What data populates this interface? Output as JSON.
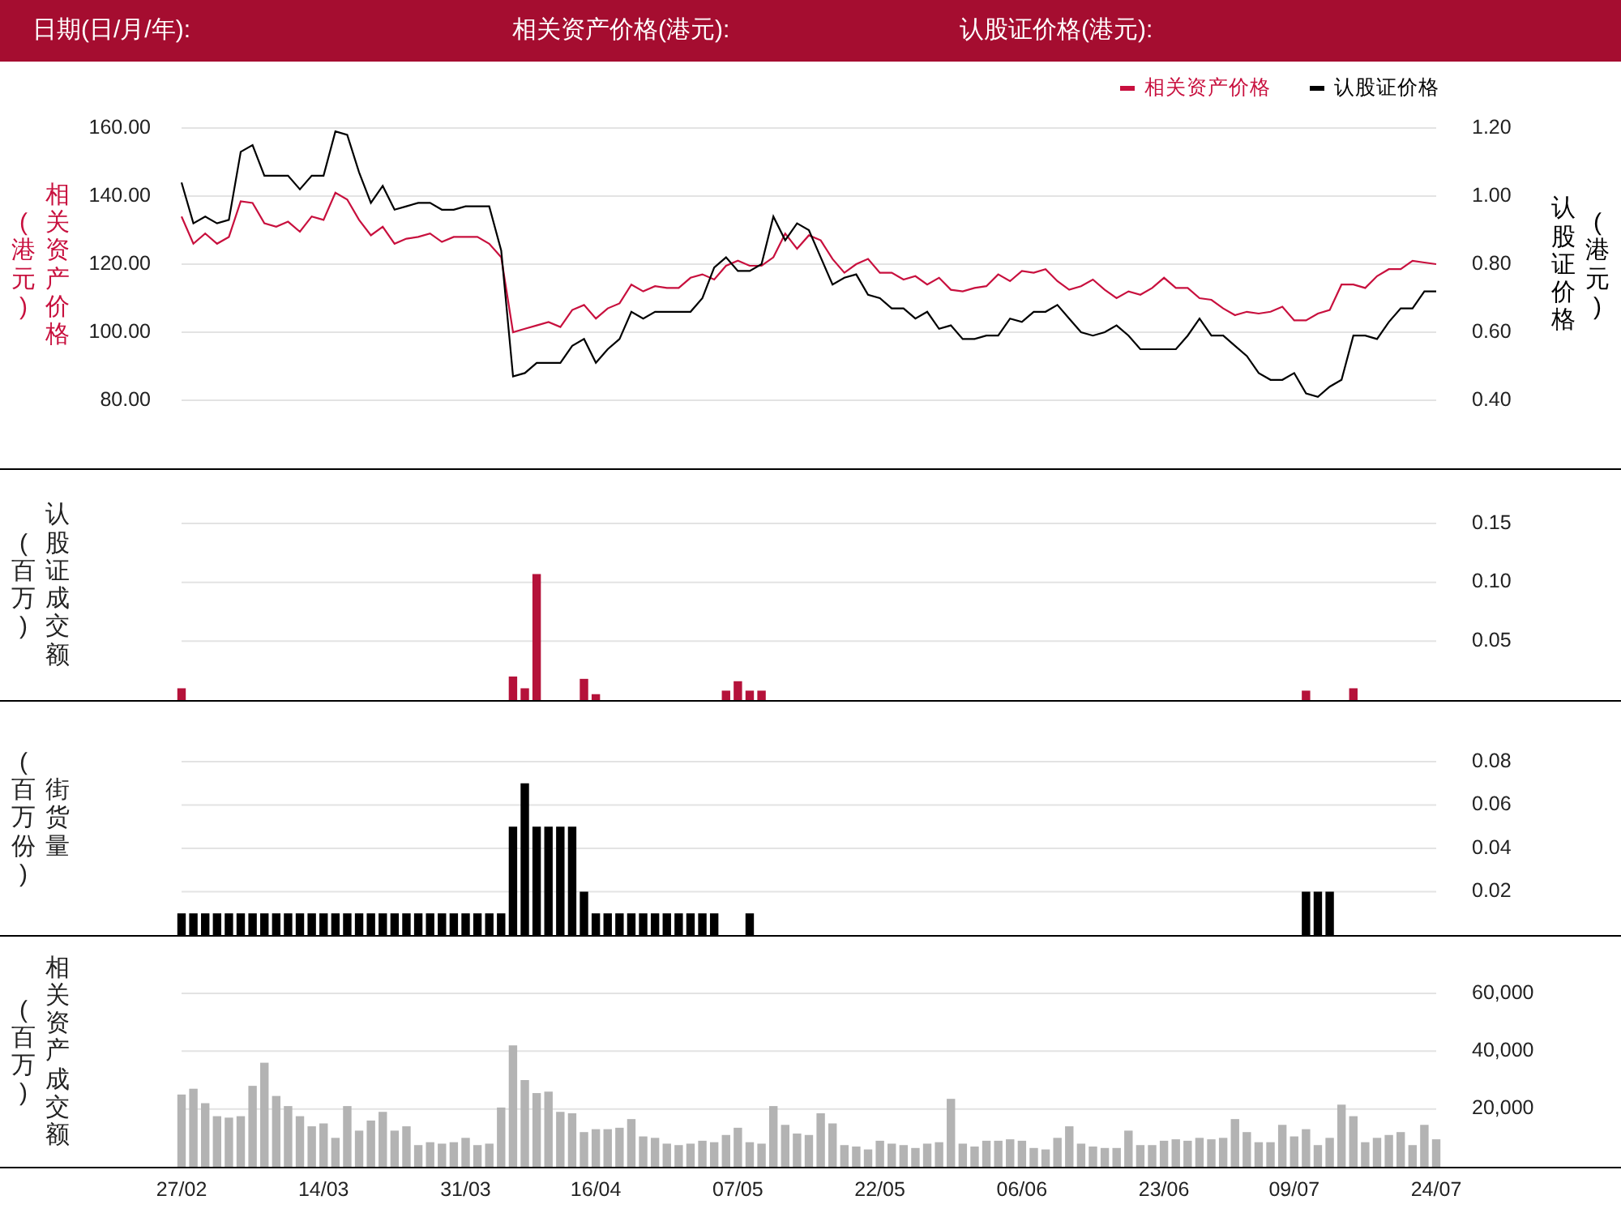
{
  "header": {
    "labels": [
      "日期(日/月/年):",
      "相关资产价格(港元):",
      "认股证价格(港元):"
    ]
  },
  "price_chart": {
    "y_unit": "(港元)",
    "y2_unit": "(港元)",
    "chart_data": {
      "type": "line",
      "ylabel": "相关资产价格",
      "y2label": "认股证价格",
      "legend": "top-right",
      "grid": true,
      "ylim": [
        80,
        160
      ],
      "y2lim": [
        0.4,
        1.2
      ],
      "yticks": [
        {
          "value": 80,
          "label": "80.00"
        },
        {
          "value": 100,
          "label": "100.00"
        },
        {
          "value": 120,
          "label": "120.00"
        },
        {
          "value": 140,
          "label": "140.00"
        },
        {
          "value": 160,
          "label": "160.00"
        }
      ],
      "y2ticks": [
        {
          "value": 0.4,
          "label": "0.40"
        },
        {
          "value": 0.6,
          "label": "0.60"
        },
        {
          "value": 0.8,
          "label": "0.80"
        },
        {
          "value": 1.0,
          "label": "1.00"
        },
        {
          "value": 1.2,
          "label": "1.20"
        }
      ],
      "series": [
        {
          "name": "相关资产价格",
          "color": "#c8103e",
          "values": [
            134,
            126,
            129,
            126,
            128,
            138.5,
            138,
            132,
            131,
            132.5,
            129.5,
            134,
            133,
            141,
            139,
            133,
            128.5,
            131,
            126,
            127.5,
            128,
            129,
            126.5,
            128,
            128,
            128,
            126,
            122,
            100,
            101,
            102,
            103,
            101.5,
            106.5,
            108,
            104,
            107,
            108.5,
            114,
            112,
            113.5,
            113,
            113,
            116,
            117,
            115.5,
            119.5,
            121,
            119.5,
            119.5,
            122,
            129,
            124.5,
            128.5,
            127,
            121.5,
            117.5,
            120,
            121.5,
            117.5,
            117.5,
            115.5,
            116.5,
            114,
            116,
            112.5,
            112,
            113,
            113.5,
            117,
            115,
            118,
            117.5,
            118.5,
            115,
            112.5,
            113.5,
            115.5,
            112.5,
            110,
            112,
            111,
            113,
            116,
            113,
            113,
            110,
            109.5,
            107,
            105,
            106,
            105.5,
            106,
            107.5,
            103.5,
            103.5,
            105.5,
            106.5,
            114,
            114,
            113,
            116.5,
            118.5,
            118.5,
            121,
            120.5,
            120
          ]
        },
        {
          "name": "认股证价格",
          "color": "#000000",
          "axis": "y2",
          "values": [
            1.04,
            0.92,
            0.94,
            0.92,
            0.93,
            1.13,
            1.15,
            1.06,
            1.06,
            1.06,
            1.02,
            1.06,
            1.06,
            1.19,
            1.18,
            1.07,
            0.98,
            1.03,
            0.96,
            0.97,
            0.98,
            0.98,
            0.96,
            0.96,
            0.97,
            0.97,
            0.97,
            0.84,
            0.47,
            0.48,
            0.51,
            0.51,
            0.51,
            0.56,
            0.58,
            0.51,
            0.55,
            0.58,
            0.66,
            0.64,
            0.66,
            0.66,
            0.66,
            0.66,
            0.7,
            0.79,
            0.82,
            0.78,
            0.78,
            0.8,
            0.94,
            0.87,
            0.92,
            0.9,
            0.82,
            0.74,
            0.76,
            0.77,
            0.71,
            0.7,
            0.67,
            0.67,
            0.64,
            0.66,
            0.61,
            0.62,
            0.58,
            0.58,
            0.59,
            0.59,
            0.64,
            0.63,
            0.66,
            0.66,
            0.68,
            0.64,
            0.6,
            0.59,
            0.6,
            0.62,
            0.59,
            0.55,
            0.55,
            0.55,
            0.55,
            0.59,
            0.64,
            0.59,
            0.59,
            0.56,
            0.53,
            0.48,
            0.46,
            0.46,
            0.48,
            0.42,
            0.41,
            0.44,
            0.46,
            0.59,
            0.59,
            0.58,
            0.63,
            0.67,
            0.67,
            0.72,
            0.72
          ]
        }
      ]
    }
  },
  "warrant_turnover_chart": {
    "y_unit": "(百万)",
    "chart_data": {
      "type": "bar",
      "ylabel": "认股证成交额",
      "grid": true,
      "ylim": [
        0,
        0.15
      ],
      "yticks": [
        {
          "value": 0.05,
          "label": "0.05"
        },
        {
          "value": 0.1,
          "label": "0.10"
        },
        {
          "value": 0.15,
          "label": "0.15"
        }
      ],
      "series": [
        {
          "color": "#b5123a",
          "values": [
            0.01,
            null,
            null,
            null,
            null,
            null,
            null,
            null,
            null,
            null,
            null,
            null,
            null,
            null,
            null,
            null,
            null,
            null,
            null,
            null,
            null,
            null,
            null,
            null,
            null,
            null,
            null,
            null,
            0.02,
            0.01,
            0.107,
            null,
            null,
            null,
            0.018,
            0.005,
            null,
            null,
            null,
            null,
            null,
            null,
            null,
            null,
            null,
            null,
            0.008,
            0.016,
            0.008,
            0.008,
            null,
            null,
            null,
            null,
            null,
            null,
            null,
            null,
            null,
            null,
            null,
            null,
            null,
            null,
            null,
            null,
            null,
            null,
            null,
            null,
            null,
            null,
            null,
            null,
            null,
            null,
            null,
            null,
            null,
            null,
            null,
            null,
            null,
            null,
            null,
            null,
            null,
            null,
            null,
            null,
            null,
            null,
            null,
            null,
            null,
            0.008,
            null,
            null,
            null,
            0.01,
            null,
            null,
            null,
            null,
            null,
            null,
            null
          ]
        }
      ]
    }
  },
  "outstanding_chart": {
    "y_unit": "(百万份)",
    "chart_data": {
      "type": "bar",
      "ylabel": "街货量",
      "grid": true,
      "ylim": [
        0,
        0.08
      ],
      "yticks": [
        {
          "value": 0.02,
          "label": "0.02"
        },
        {
          "value": 0.04,
          "label": "0.04"
        },
        {
          "value": 0.06,
          "label": "0.06"
        },
        {
          "value": 0.08,
          "label": "0.08"
        }
      ],
      "series": [
        {
          "color": "#000000",
          "values": [
            0.01,
            0.01,
            0.01,
            0.01,
            0.01,
            0.01,
            0.01,
            0.01,
            0.01,
            0.01,
            0.01,
            0.01,
            0.01,
            0.01,
            0.01,
            0.01,
            0.01,
            0.01,
            0.01,
            0.01,
            0.01,
            0.01,
            0.01,
            0.01,
            0.01,
            0.01,
            0.01,
            0.01,
            0.05,
            0.07,
            0.05,
            0.05,
            0.05,
            0.05,
            0.02,
            0.01,
            0.01,
            0.01,
            0.01,
            0.01,
            0.01,
            0.01,
            0.01,
            0.01,
            0.01,
            0.01,
            null,
            null,
            0.01,
            null,
            null,
            null,
            null,
            null,
            null,
            null,
            null,
            null,
            null,
            null,
            null,
            null,
            null,
            null,
            null,
            null,
            null,
            null,
            null,
            null,
            null,
            null,
            null,
            null,
            null,
            null,
            null,
            null,
            null,
            null,
            null,
            null,
            null,
            null,
            null,
            null,
            null,
            null,
            null,
            null,
            null,
            null,
            null,
            null,
            null,
            0.02,
            0.02,
            0.02,
            null,
            null,
            null,
            null,
            null,
            null,
            null,
            null,
            null
          ]
        }
      ]
    }
  },
  "asset_turnover_chart": {
    "y_unit": "(百万)",
    "chart_data": {
      "type": "bar",
      "ylabel": "相关资产成交额",
      "grid": true,
      "ylim": [
        0,
        60000
      ],
      "categories": [
        "27/02",
        null,
        null,
        null,
        null,
        null,
        null,
        null,
        null,
        null,
        null,
        null,
        "14/03",
        null,
        null,
        null,
        null,
        null,
        null,
        null,
        null,
        null,
        null,
        null,
        "31/03",
        null,
        null,
        null,
        null,
        null,
        null,
        null,
        null,
        null,
        null,
        "16/04",
        null,
        null,
        null,
        null,
        null,
        null,
        null,
        null,
        null,
        null,
        null,
        "07/05",
        null,
        null,
        null,
        null,
        null,
        null,
        null,
        null,
        null,
        null,
        null,
        "22/05",
        null,
        null,
        null,
        null,
        null,
        null,
        null,
        null,
        null,
        null,
        null,
        "06/06",
        null,
        null,
        null,
        null,
        null,
        null,
        null,
        null,
        null,
        null,
        null,
        "23/06",
        null,
        null,
        null,
        null,
        null,
        null,
        null,
        null,
        null,
        null,
        "09/07",
        null,
        null,
        null,
        null,
        null,
        null,
        null,
        null,
        null,
        null,
        null,
        "24/07"
      ],
      "yticks": [
        {
          "value": 20000,
          "label": "20,000"
        },
        {
          "value": 40000,
          "label": "40,000"
        },
        {
          "value": 60000,
          "label": "60,000"
        }
      ],
      "series": [
        {
          "color": "#b3b3b3",
          "values": [
            25000,
            27000,
            22000,
            17500,
            17000,
            17500,
            28000,
            36000,
            24500,
            21000,
            17500,
            14000,
            15000,
            10000,
            21000,
            12500,
            16000,
            19000,
            12500,
            14000,
            7500,
            8500,
            8000,
            8500,
            10000,
            7500,
            8000,
            20500,
            42000,
            30000,
            25500,
            26000,
            19000,
            18500,
            12000,
            13000,
            13000,
            13500,
            16500,
            10500,
            10000,
            8000,
            7500,
            8000,
            9000,
            8500,
            11000,
            13500,
            8500,
            8000,
            21000,
            14500,
            11500,
            11000,
            18500,
            15000,
            7500,
            7000,
            6000,
            9000,
            8000,
            7500,
            6500,
            8000,
            8500,
            23500,
            8000,
            7000,
            9000,
            9000,
            9500,
            9000,
            6500,
            6000,
            10000,
            14000,
            8000,
            7000,
            6500,
            6500,
            12500,
            7500,
            7500,
            9000,
            9500,
            9000,
            10000,
            9500,
            10000,
            16500,
            12000,
            8500,
            8500,
            14500,
            10500,
            13000,
            7500,
            10000,
            21500,
            17500,
            8500,
            10000,
            11000,
            12000,
            7500,
            14500,
            9500
          ]
        }
      ]
    }
  }
}
